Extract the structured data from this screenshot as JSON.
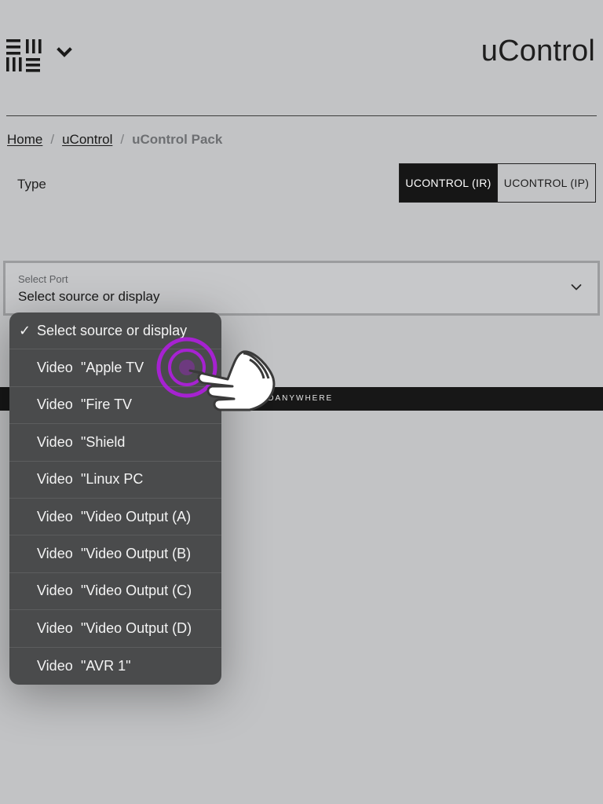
{
  "header": {
    "title": "uControl",
    "logo_icon": "grid-menu-logo-icon",
    "dropdown_icon": "chevron-down-icon"
  },
  "breadcrumb": {
    "home": "Home",
    "sep": "/",
    "section": "uControl",
    "current": "uControl Pack"
  },
  "type": {
    "label": "Type",
    "options": [
      "UCONTROL (IR)",
      "UCONTROL (IP)"
    ],
    "selected": "UCONTROL (IR)"
  },
  "select": {
    "label": "Select Port",
    "value": "Select source or display",
    "chevron_icon": "chevron-down-icon"
  },
  "bar": {
    "text": "HDANYWHERE"
  },
  "dropdown": {
    "check_mark": "✓",
    "options": [
      {
        "prefix": "",
        "label": "Select source or display",
        "selected": true
      },
      {
        "prefix": "Video",
        "label": "\"Apple TV"
      },
      {
        "prefix": "Video",
        "label": "\"Fire TV"
      },
      {
        "prefix": "Video",
        "label": "\"Shield"
      },
      {
        "prefix": "Video",
        "label": "\"Linux PC"
      },
      {
        "prefix": "Video",
        "label": "\"Video Output (A)"
      },
      {
        "prefix": "Video",
        "label": "\"Video Output (B)"
      },
      {
        "prefix": "Video",
        "label": "\"Video Output (C)"
      },
      {
        "prefix": "Video",
        "label": "\"Video Output (D)"
      },
      {
        "prefix": "Video",
        "label": "\"AVR  1\""
      }
    ]
  },
  "overlay": {
    "icon": "tap-hand-icon",
    "ring_color": "#b01ee0"
  }
}
